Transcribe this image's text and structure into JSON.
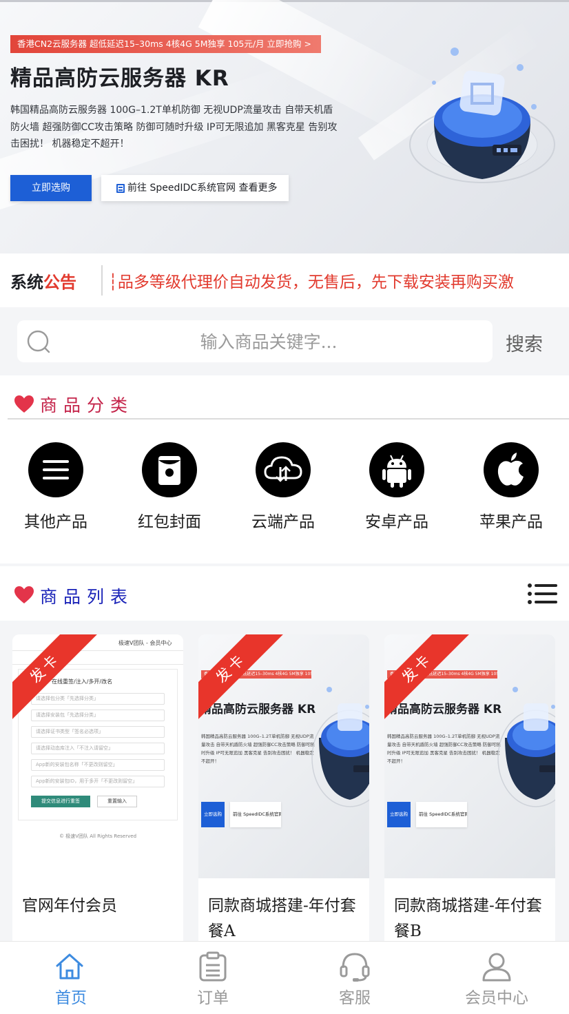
{
  "colors": {
    "brand_blue": "#1d5fd6",
    "accent_red": "#e23a2e",
    "category_title": "#c4244a",
    "list_title": "#1a23b8",
    "nav_active": "#3d8be0"
  },
  "banner": {
    "promo": "香港CN2云服务器 超低延迟15–30ms 4核4G 5M独享 105元/月 立即抢购 >",
    "title": "精品高防云服务器 KR",
    "description": "韩国精品高防云服务器 100G–1.2T单机防御 无视UDP流量攻击 自带天机盾防火墙 超强防御CC攻击策略 防御可随时升级 IP可无限追加 黑客克星 告别攻击困扰！ 机器稳定不超开！",
    "primary_button": "立即选购",
    "secondary_button": "前往 SpeedIDC系统官网 查看更多"
  },
  "announcement": {
    "label_main": "系统",
    "label_accent": "公告",
    "text": "┆品多等级代理价自动发货，无售后，先下载安装再购买激"
  },
  "search": {
    "placeholder": "输入商品关键字...",
    "button": "搜索"
  },
  "categories": {
    "title": "商品分类",
    "items": [
      {
        "label": "其他产品",
        "icon": "menu-icon"
      },
      {
        "label": "红包封面",
        "icon": "red-packet-icon"
      },
      {
        "label": "云端产品",
        "icon": "cloud-icon"
      },
      {
        "label": "安卓产品",
        "icon": "android-icon"
      },
      {
        "label": "苹果产品",
        "icon": "apple-icon"
      }
    ]
  },
  "product_list": {
    "title": "商品列表",
    "ribbon": "发卡",
    "items": [
      {
        "title": "官网年付会员",
        "thumb": {
          "header": "极速V团队 - 会员中心",
          "heading": "在线重签/注入/多开/改名",
          "fields": [
            "请选择包分类「先选择分类」",
            "请选择安装包「先选择分类」",
            "请选择证书类型「签名必选项」",
            "请选择动态库注入「不注入请留空」",
            "App新的安装包名称「不更改则留空」",
            "App新的安装包ID，用于多开「不更改则留空」"
          ],
          "submit": "提交信息进行重签",
          "reset": "重置输入",
          "footer": "© 极速V团队 All Rights Reserved"
        }
      },
      {
        "title": "同款商城搭建-年付套餐A",
        "thumb": {
          "promo": "香港CN2云服务器 超低延迟15–30ms 4核4G 5M独享 105元/月 立即抢购",
          "title": "精品高防云服务器 KR",
          "description": "韩国精品高防云服务器 100G–1.2T单机防御 无视UDP流量攻击 自带天机盾防火墙 超强防御CC攻击策略 防御可随时升级 IP可无限追加 黑客克星 告别攻击困扰！ 机器稳定不超开！",
          "btn1": "立即选购",
          "btn2": "前往 SpeedIDC系统官网 查看更多"
        }
      },
      {
        "title": "同款商城搭建-年付套餐B",
        "thumb": {
          "promo": "香港CN2云服务器 超低延迟15–30ms 4核4G 5M独享 105元/月 立即抢购",
          "title": "精品高防云服务器 KR",
          "description": "韩国精品高防云服务器 100G–1.2T单机防御 无视UDP流量攻击 自带天机盾防火墙 超强防御CC攻击策略 防御可随时升级 IP可无限追加 黑客克星 告别攻击困扰！ 机器稳定不超开！",
          "btn1": "立即选购",
          "btn2": "前往 SpeedIDC系统官网 查看更多"
        }
      }
    ]
  },
  "bottom_nav": [
    {
      "label": "首页",
      "icon": "home-icon",
      "active": true
    },
    {
      "label": "订单",
      "icon": "order-icon",
      "active": false
    },
    {
      "label": "客服",
      "icon": "headset-icon",
      "active": false
    },
    {
      "label": "会员中心",
      "icon": "user-icon",
      "active": false
    }
  ]
}
